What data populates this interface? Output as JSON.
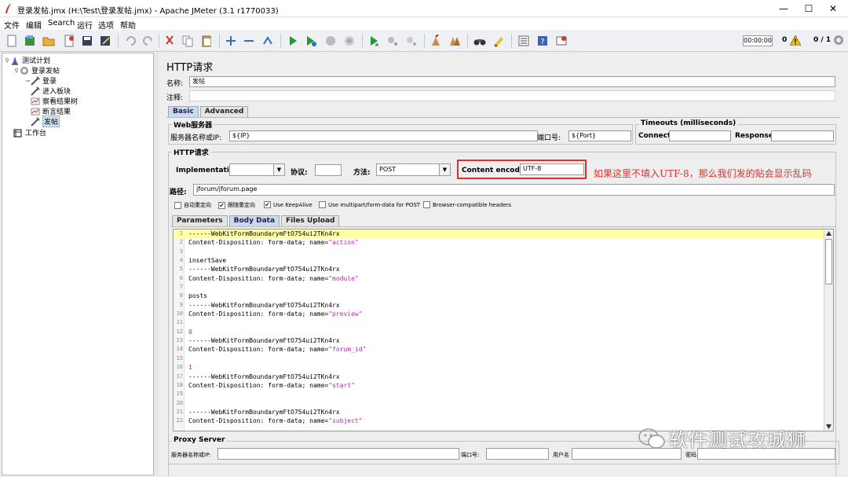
{
  "window": {
    "title": "登录发帖.jmx (H:\\Test\\登录发帖.jmx) - Apache JMeter (3.1 r1770033)",
    "minimize": "—",
    "maximize": "☐",
    "close": "✕"
  },
  "menu": [
    "文件",
    "编辑",
    "Search",
    "运行",
    "选项",
    "帮助"
  ],
  "toolbar": {
    "timer": "00:00:00",
    "error_count": "0",
    "threads": "0 / 1",
    "icons": [
      "new-icon",
      "templates-icon",
      "open-icon",
      "close-icon",
      "save-icon",
      "save-as-icon",
      "undo-icon",
      "redo-icon",
      "cut-icon",
      "copy-icon",
      "paste-icon",
      "expand-icon",
      "collapse-icon",
      "toggle-icon",
      "start-icon",
      "start-no-pause-icon",
      "stop-icon",
      "shutdown-icon",
      "remote-start-icon",
      "remote-stop-icon",
      "remote-shutdown-icon",
      "clear-icon",
      "clear-all-icon",
      "search-icon",
      "reset-search-icon",
      "function-helper-icon",
      "help-icon",
      "log-viewer-icon"
    ]
  },
  "tree": {
    "nodes": [
      {
        "label": "测试计划",
        "icon": "test-plan-icon"
      },
      {
        "label": "登录发帖",
        "icon": "thread-group-icon"
      },
      {
        "label": "登录",
        "icon": "sampler-icon"
      },
      {
        "label": "进入板块",
        "icon": "sampler-icon"
      },
      {
        "label": "察看结果树",
        "icon": "listener-icon"
      },
      {
        "label": "断言结果",
        "icon": "listener-icon"
      },
      {
        "label": "发帖",
        "icon": "sampler-icon"
      },
      {
        "label": "工作台",
        "icon": "workbench-icon"
      }
    ]
  },
  "panel": {
    "heading": "HTTP请求",
    "name_label": "名称:",
    "name_value": "发帖",
    "comment_label": "注释:",
    "comment_value": "",
    "tabs": [
      "Basic",
      "Advanced"
    ],
    "web_server": {
      "title": "Web服务器",
      "server_label": "服务器名称或IP:",
      "server_value": "${IP}",
      "port_label": "端口号:",
      "port_value": "${Port}"
    },
    "timeouts": {
      "title": "Timeouts (milliseconds)",
      "connect_label": "Connect:",
      "connect_value": "",
      "response_label": "Response:",
      "response_value": ""
    },
    "http_request": {
      "title": "HTTP请求",
      "implementation_label": "Implementation:",
      "implementation_value": "",
      "protocol_label": "协议:",
      "protocol_value": "",
      "method_label": "方法:",
      "method_value": "POST",
      "encoding_label": "Content encoding:",
      "encoding_value": "UTF-8",
      "path_label": "路径:",
      "path_value": "jforum/jforum.page"
    },
    "checkboxes": [
      {
        "label": "自动重定向",
        "checked": false
      },
      {
        "label": "跟随重定向",
        "checked": true
      },
      {
        "label": "Use KeepAlive",
        "checked": true
      },
      {
        "label": "Use multipart/form-data for POST",
        "checked": false
      },
      {
        "label": "Browser-compatible headers",
        "checked": false
      }
    ],
    "body_tabs": [
      "Parameters",
      "Body Data",
      "Files Upload"
    ],
    "annotation": "如果这里不填入UTF-8，那么我们发的贴会显示乱码",
    "proxy": {
      "title": "Proxy Server",
      "server_label": "服务器名称或IP:",
      "server_value": "",
      "port_label": "端口号:",
      "port_value": "",
      "user_label": "用户名",
      "user_value": "",
      "password_label": "密码",
      "password_value": ""
    }
  },
  "body_lines": [
    {
      "n": "1",
      "a": "------WebKitFormBoundarymFtO754ui2TKn4rx",
      "s": ""
    },
    {
      "n": "2",
      "a": "Content-Disposition: form-data; name=",
      "s": "\"action\""
    },
    {
      "n": "3",
      "a": "",
      "s": ""
    },
    {
      "n": "4",
      "a": "insertSave",
      "s": ""
    },
    {
      "n": "5",
      "a": "------WebKitFormBoundarymFtO754ui2TKn4rx",
      "s": ""
    },
    {
      "n": "6",
      "a": "Content-Disposition: form-data; name=",
      "s": "\"module\""
    },
    {
      "n": "7",
      "a": "",
      "s": ""
    },
    {
      "n": "8",
      "a": "posts",
      "s": ""
    },
    {
      "n": "9",
      "a": "------WebKitFormBoundarymFtO754ui2TKn4rx",
      "s": ""
    },
    {
      "n": "10",
      "a": "Content-Disposition: form-data; name=",
      "s": "\"preview\""
    },
    {
      "n": "11",
      "a": "",
      "s": ""
    },
    {
      "n": "12",
      "a": "",
      "s": "0"
    },
    {
      "n": "13",
      "a": "------WebKitFormBoundarymFtO754ui2TKn4rx",
      "s": ""
    },
    {
      "n": "14",
      "a": "Content-Disposition: form-data; name=",
      "s": "\"forum_id\""
    },
    {
      "n": "15",
      "a": "",
      "s": ""
    },
    {
      "n": "16",
      "a": "",
      "s": "1"
    },
    {
      "n": "17",
      "a": "------WebKitFormBoundarymFtO754ui2TKn4rx",
      "s": ""
    },
    {
      "n": "18",
      "a": "Content-Disposition: form-data; name=",
      "s": "\"start\""
    },
    {
      "n": "19",
      "a": "",
      "s": ""
    },
    {
      "n": "20",
      "a": "",
      "s": ""
    },
    {
      "n": "21",
      "a": "------WebKitFormBoundarymFtO754ui2TKn4rx",
      "s": ""
    },
    {
      "n": "22",
      "a": "Content-Disposition: form-data; name=",
      "s": "\"subject\""
    }
  ],
  "watermark": "软件测试攻城狮",
  "colors": {
    "accent_red": "#d9322f",
    "selected_tab": "#c9daf0",
    "current_line": "#ffffaa",
    "string": "#b22bb2"
  }
}
